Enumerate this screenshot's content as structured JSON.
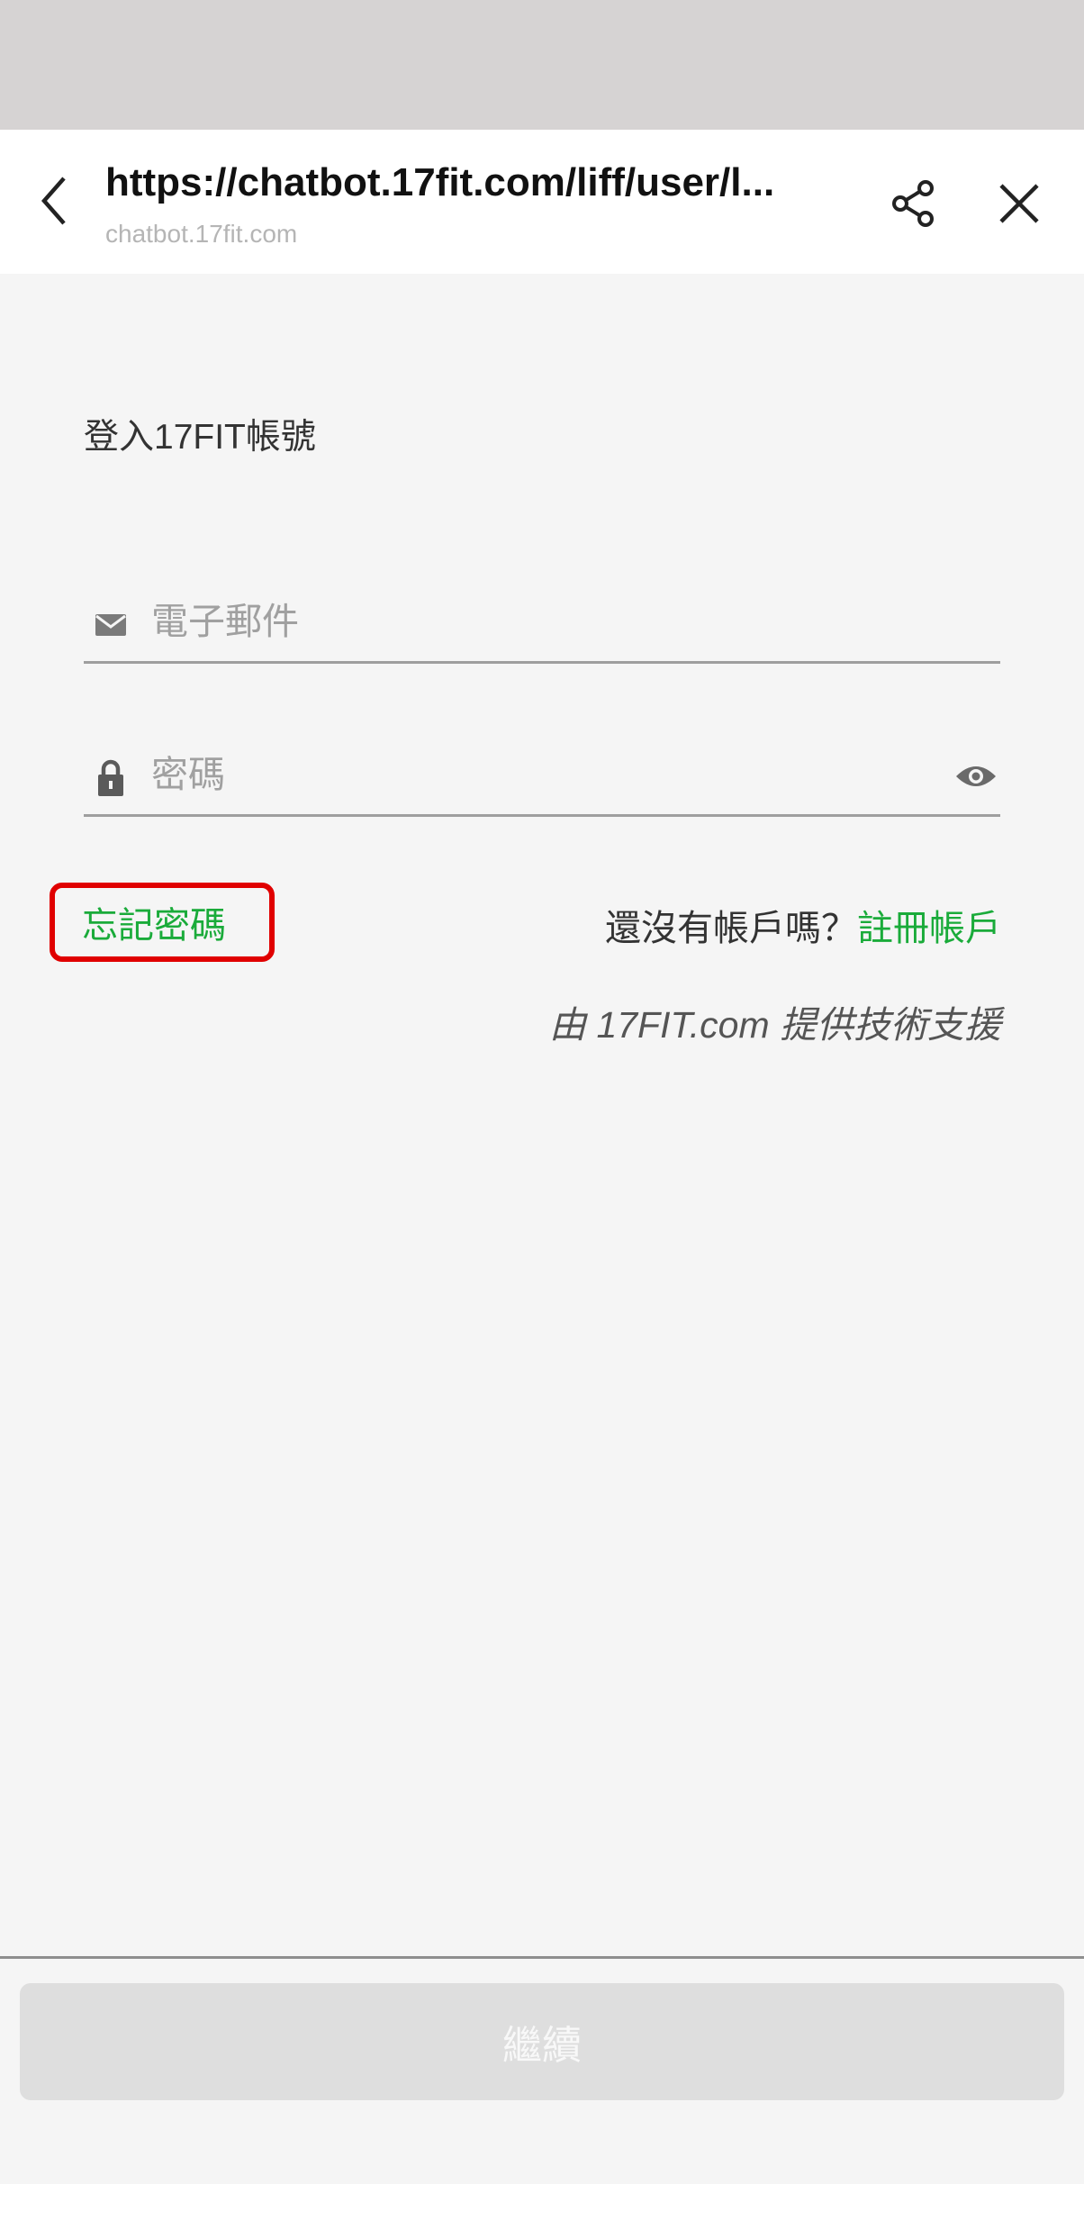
{
  "browser": {
    "url_title": "https://chatbot.17fit.com/liff/user/l...",
    "domain": "chatbot.17fit.com"
  },
  "login": {
    "heading": "登入17FIT帳號",
    "email_placeholder": "電子郵件",
    "password_placeholder": "密碼",
    "forgot_password": "忘記密碼",
    "no_account_prompt": "還沒有帳戶嗎？",
    "signup_link": "註冊帳戶",
    "powered_by": "由 17FIT.com 提供技術支援",
    "continue_label": "繼續"
  },
  "colors": {
    "accent_green": "#1aab3a",
    "highlight_red": "#e00000",
    "status_bar": "#d6d3d3",
    "background": "#f5f5f5",
    "button_disabled": "#dedede"
  },
  "icons": {
    "back": "chevron-left-icon",
    "share": "share-icon",
    "close": "close-icon",
    "email": "mail-icon",
    "password": "lock-icon",
    "show_password": "eye-icon"
  }
}
